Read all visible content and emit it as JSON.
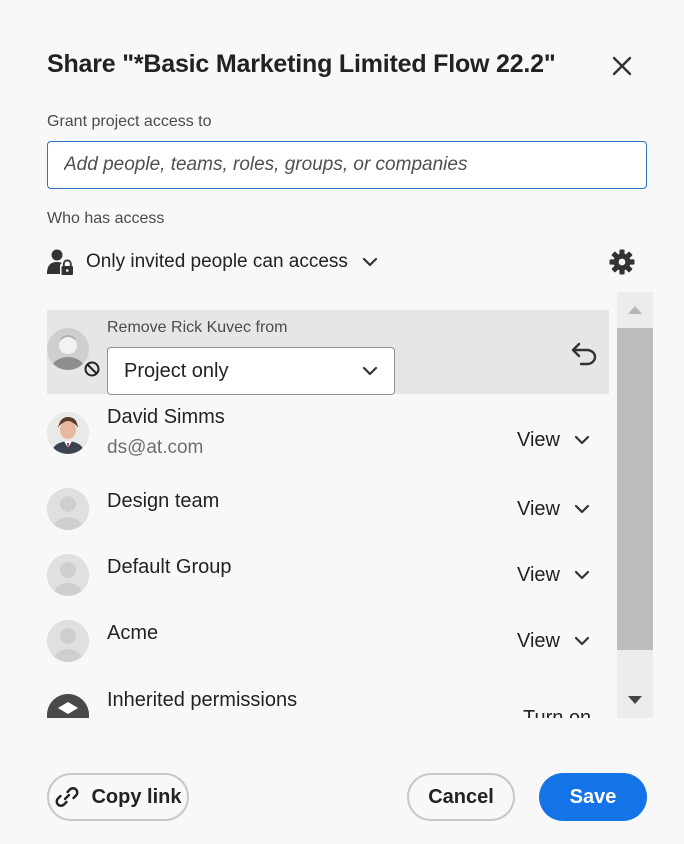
{
  "dialog": {
    "title": "Share \"*Basic Marketing Limited Flow 22.2\"",
    "grant_label": "Grant project access to",
    "add_placeholder": "Add people, teams, roles, groups, or companies",
    "add_value": "",
    "who_has_access_label": "Who has access",
    "access_mode": "Only invited people can access"
  },
  "pending_removal": {
    "label": "Remove Rick Kuvec from",
    "scope_value": "Project only"
  },
  "members": [
    {
      "name": "David Simms",
      "email": "ds@at.com",
      "permission": "View"
    },
    {
      "name": "Design team",
      "email": "",
      "permission": "View"
    },
    {
      "name": "Default Group",
      "email": "",
      "permission": "View"
    },
    {
      "name": "Acme",
      "email": "",
      "permission": "View"
    }
  ],
  "inherited": {
    "label": "Inherited permissions",
    "action": "Turn on"
  },
  "footer": {
    "copy_link": "Copy link",
    "cancel": "Cancel",
    "save": "Save"
  },
  "colors": {
    "accent": "#1473e6",
    "input_focus": "#2f74c0",
    "background": "#f8f8f8",
    "highlight_row": "#e6e6e6"
  },
  "icons": [
    "close-icon",
    "person-lock-icon",
    "chevron-down-icon",
    "gear-icon",
    "ban-icon",
    "undo-icon",
    "link-icon",
    "scroll-up-icon",
    "scroll-down-icon",
    "inherited-icon"
  ]
}
